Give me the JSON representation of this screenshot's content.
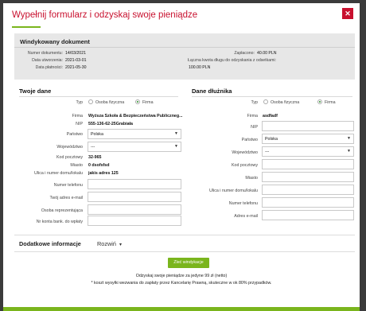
{
  "modal": {
    "title": "Wypełnij formularz i odzyskaj swoje pieniądze",
    "close_icon": "close-icon",
    "accent": "#c8102e",
    "green": "#7ab51d"
  },
  "document": {
    "heading": "Windykowany dokument",
    "numer_label": "Numer dokumentu:",
    "numer_value": "14/03/2021",
    "utworzenie_label": "Data utworzenia:",
    "utworzenie_value": "2021-03-01",
    "platnosc_label": "Data płatności:",
    "platnosc_value": "2021-05-30",
    "zaplacono_label": "Zapłacono:",
    "zaplacono_value": "40.00 PLN",
    "laczna_label": "Łączna kwota długu do odzyskania z odsetkami:",
    "laczna_value": "100.00 PLN"
  },
  "twoje": {
    "title": "Twoje dane",
    "typ_label": "Typ",
    "osoba_label": "Osoba fizyczna",
    "firma_label": "Firma",
    "firma_field_label": "Firma",
    "firma_value": "Wyższa Szkoła & Bezpieczeństwa Publiczneg...",
    "nip_label": "NIP",
    "nip_value": "555-136-62-25Grabiała",
    "panstwo_label": "Państwo",
    "panstwo_value": "Polska",
    "wojewodztwo_label": "Województwo",
    "wojewodztwo_value": "---",
    "kod_label": "Kod pocztowy",
    "kod_value": "32-965",
    "miasto_label": "Miasto",
    "miasto_value": "0 dsofsfsd",
    "ulica_label": "Ulica i numer domu/lokalu",
    "ulica_value": "jakis adres 125",
    "telefon_label": "Numer telefonu",
    "email_label": "Twój adres e-mail",
    "osoba_rep_label": "Osoba reprezentująca",
    "konto_label": "Nr konta bank. do wpłaty"
  },
  "dluznik": {
    "title": "Dane dłużnika",
    "typ_label": "Typ",
    "osoba_label": "Osoba fizyczna",
    "firma_label": "Firma",
    "firma_field_label": "Firma",
    "firma_value": "asdfadf",
    "nip_label": "NIP",
    "panstwo_label": "Państwo",
    "panstwo_value": "Polska",
    "wojewodztwo_label": "Województwo",
    "wojewodztwo_value": "---",
    "kod_label": "Kod pocztowy",
    "miasto_label": "Miasto",
    "ulica_label": "Ulica i numer domu/lokalu",
    "telefon_label": "Numer telefonu",
    "email_label": "Adres e-mail"
  },
  "extra": {
    "title": "Dodatkowe informacje",
    "toggle": "Rozwiń",
    "toggle_icon": "chevron-down-icon"
  },
  "footer": {
    "submit_label": "Zleć windykacje",
    "note1": "Odzyskaj swoje pieniądze za jedyne 99 zł (netto)",
    "note2": "* koszt wysyłki wezwania do zapłaty przez Kancelarię Prawną, skuteczne w ok 80% przypadków."
  }
}
